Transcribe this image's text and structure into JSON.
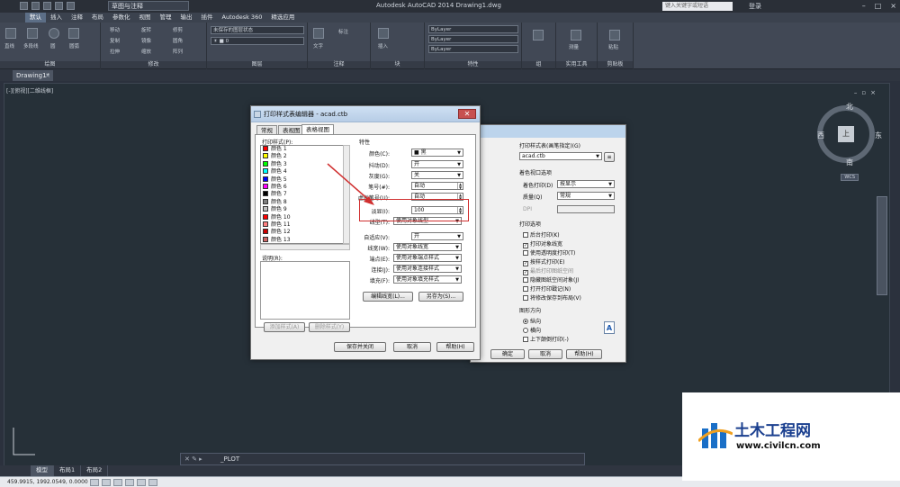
{
  "titlebar": {
    "workspace": "草图与注释",
    "app_title": "Autodesk AutoCAD 2014    Drawing1.dwg",
    "search_placeholder": "键入关键字或短语",
    "login": "登录"
  },
  "menu": [
    "默认",
    "插入",
    "注释",
    "布局",
    "参数化",
    "视图",
    "管理",
    "输出",
    "插件",
    "Autodesk 360",
    "精选应用"
  ],
  "ribbon": {
    "groups": [
      "绘图",
      "修改",
      "图层",
      "注释",
      "块",
      "特性",
      "组",
      "实用工具",
      "剪贴板"
    ],
    "draw_tools": [
      "直线",
      "多段线",
      "圆",
      "圆弧"
    ],
    "modify_tools": [
      "移动",
      "旋转",
      "修剪",
      "复制",
      "镜像",
      "圆角",
      "拉伸",
      "缩放",
      "阵列"
    ],
    "layer_state": "未保存的图层状态",
    "text_label": "文字",
    "dim_label": "标注",
    "insert_label": "插入",
    "props": [
      "ByLayer",
      "ByLayer",
      "ByLayer"
    ],
    "group_label": "组",
    "measure_label": "测量",
    "paste_label": "粘贴"
  },
  "doc_tab": "Drawing1*",
  "viewport_label": "[-][俯视][二维线框]",
  "viewcube": {
    "north": "北",
    "south": "南",
    "east": "东",
    "west": "西",
    "face": "上",
    "wcs": "WCS"
  },
  "cmdline": "_PLOT",
  "layout_tabs": [
    "模型",
    "布局1",
    "布局2"
  ],
  "status": {
    "coords": "459.9915, 1992.0549, 0.0000"
  },
  "editor": {
    "title": "打印样式表编辑器 - acad.ctb",
    "tabs": [
      "常规",
      "表视图",
      "表格视图"
    ],
    "styles_label": "打印样式(P):",
    "styles": [
      {
        "name": "颜色 1",
        "color": "#ff0000"
      },
      {
        "name": "颜色 2",
        "color": "#ffff00"
      },
      {
        "name": "颜色 3",
        "color": "#00ff00"
      },
      {
        "name": "颜色 4",
        "color": "#00ffff"
      },
      {
        "name": "颜色 5",
        "color": "#0000ff"
      },
      {
        "name": "颜色 6",
        "color": "#ff00ff"
      },
      {
        "name": "颜色 7",
        "color": "#000000"
      },
      {
        "name": "颜色 8",
        "color": "#808080"
      },
      {
        "name": "颜色 9",
        "color": "#c0c0c0"
      },
      {
        "name": "颜色 10",
        "color": "#ff0000"
      },
      {
        "name": "颜色 11",
        "color": "#ff7f7f"
      },
      {
        "name": "颜色 12",
        "color": "#cc0000"
      },
      {
        "name": "颜色 13",
        "color": "#cc6666"
      }
    ],
    "desc_label": "说明(R):",
    "props_header": "特性",
    "color_label": "颜色(C):",
    "color_value": "■ 黑",
    "dither_label": "抖动(D):",
    "dither_value": "开",
    "gray_label": "灰度(G):",
    "gray_value": "关",
    "pen_label": "笔号(#):",
    "pen_value": "自动",
    "vpen_label": "虚拟笔号(U):",
    "vpen_value": "自动",
    "screen_label": "淡显(I):",
    "screen_value": "100",
    "linetype_label": "线型(T):",
    "linetype_value": "使用对象线型",
    "adaptive_label": "自适应(V):",
    "adaptive_value": "开",
    "lineweight_label": "线宽(W):",
    "lineweight_value": "使用对象线宽",
    "endstyle_label": "端点(E):",
    "endstyle_value": "使用对象端点样式",
    "joinstyle_label": "连接(J):",
    "joinstyle_value": "使用对象连接样式",
    "fill_label": "填充(F):",
    "fill_value": "使用对象填充样式",
    "edit_lw": "编辑线宽(L)...",
    "saveas": "另存为(S)...",
    "add_style": "添加样式(A)",
    "del_style": "删除样式(Y)",
    "save_close": "保存并关闭",
    "cancel": "取消",
    "help": "帮助(H)"
  },
  "plot": {
    "table_label": "打印样式表(画笔指定)(G)",
    "table_value": "acad.ctb",
    "shade_header": "着色视口选项",
    "shade_label": "着色打印(D)",
    "shade_value": "按显示",
    "quality_label": "质量(Q)",
    "quality_value": "常规",
    "dpi_label": "DPI",
    "options_header": "打印选项",
    "options": [
      {
        "t": "后台打印(K)",
        "c": false
      },
      {
        "t": "打印对象线宽",
        "c": true
      },
      {
        "t": "使用透明度打印(T)",
        "c": false
      },
      {
        "t": "按样式打印(E)",
        "c": true
      },
      {
        "t": "最后打印图纸空间",
        "c": true
      },
      {
        "t": "隐藏图纸空间对象(J)",
        "c": false
      },
      {
        "t": "打开打印戳记(N)",
        "c": false
      },
      {
        "t": "将修改保存到布局(V)",
        "c": false
      }
    ],
    "orient_header": "图形方向",
    "portrait": "纵向",
    "landscape": "横向",
    "upside": "上下颠倒打印(-)",
    "ok": "确定",
    "cancel": "取消",
    "help": "帮助(H)"
  },
  "watermark": {
    "title": "土木工程网",
    "url": "www.civilcn.com"
  }
}
